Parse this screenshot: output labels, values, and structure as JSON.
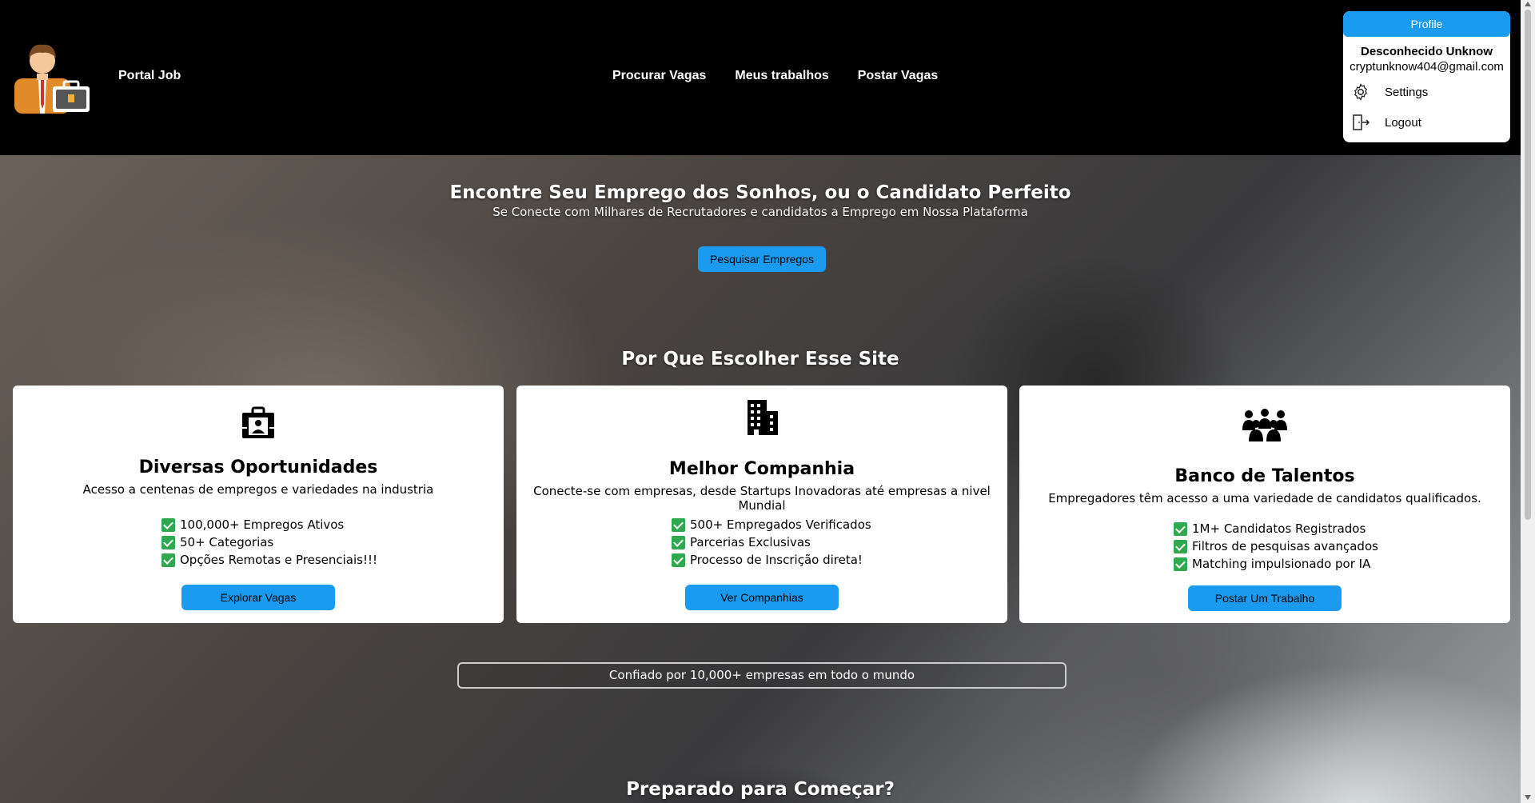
{
  "header": {
    "brand": "Portal Job",
    "nav": [
      "Procurar Vagas",
      "Meus trabalhos",
      "Postar Vagas"
    ]
  },
  "profile_menu": {
    "button": "Profile",
    "name": "Desconhecido Unknow",
    "email": "cryptunknow404@gmail.com",
    "items": [
      {
        "label": "Settings",
        "icon": "gear-icon"
      },
      {
        "label": "Logout",
        "icon": "logout-icon"
      }
    ]
  },
  "hero": {
    "title": "Encontre Seu Emprego dos Sonhos, ou o Candidato Perfeito",
    "subtitle": "Se Conecte com Milhares de Recrutadores e candidatos a Emprego em Nossa Plataforma",
    "button": "Pesquisar Empregos"
  },
  "why": {
    "title": "Por Que Escolher Esse Site"
  },
  "cards": [
    {
      "icon": "briefcase-icon",
      "title": "Diversas Oportunidades",
      "desc": "Acesso a centenas de empregos e variedades na industria",
      "items": [
        "100,000+ Empregos Ativos",
        "50+ Categorias",
        "Opções Remotas e Presenciais!!!"
      ],
      "button": "Explorar Vagas"
    },
    {
      "icon": "building-icon",
      "title": "Melhor Companhia",
      "desc": "Conecte-se com empresas, desde Startups Inovadoras até empresas a nivel Mundial",
      "items": [
        "500+ Empregados Verificados",
        "Parcerias Exclusivas",
        "Processo de Inscrição direta!"
      ],
      "button": "Ver Companhias"
    },
    {
      "icon": "team-icon",
      "title": "Banco de Talentos",
      "desc": "Empregadores têm acesso a uma variedade de candidatos qualificados.",
      "items": [
        "1M+ Candidatos Registrados",
        "Filtros de pesquisas avançados",
        "Matching impulsionado por IA"
      ],
      "button": "Postar Um Trabalho"
    }
  ],
  "trusted": "Confiado por 10,000+ empresas em todo o mundo",
  "ready": "Preparado para Começar?",
  "colors": {
    "accent": "#1a9bf0",
    "check": "#2fa84f",
    "header": "#000000"
  }
}
